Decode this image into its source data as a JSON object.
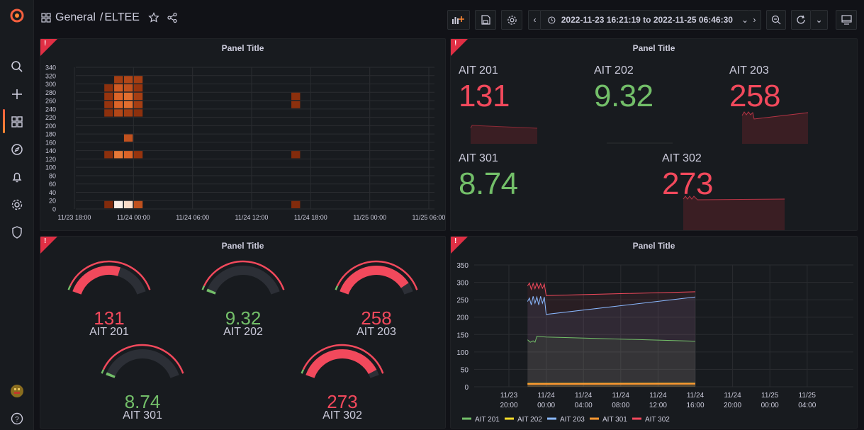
{
  "app": {
    "breadcrumb_folder": "General",
    "breadcrumb_sep": "/",
    "breadcrumb_dashboard": "ELTEE",
    "time_range": "2022-11-23 16:21:19 to 2022-11-25 06:46:30"
  },
  "sidebar": {
    "items": [
      {
        "icon": "grafana-logo-icon"
      },
      {
        "icon": "search-icon"
      },
      {
        "icon": "plus-icon"
      },
      {
        "icon": "dashboards-icon"
      },
      {
        "icon": "explore-compass-icon"
      },
      {
        "icon": "alerting-bell-icon"
      },
      {
        "icon": "config-gear-icon"
      },
      {
        "icon": "shield-icon"
      },
      {
        "icon": "user-avatar-icon"
      },
      {
        "icon": "help-icon"
      }
    ]
  },
  "panels": {
    "heatmap": {
      "title": "Panel Title",
      "error_mark": "!"
    },
    "stats": {
      "title": "Panel Title",
      "error_mark": "!"
    },
    "gauges": {
      "title": "Panel Title",
      "error_mark": "!"
    },
    "timeseries": {
      "title": "Panel Title",
      "error_mark": "!"
    }
  },
  "colors": {
    "red": "#f2495c",
    "green": "#73bf69",
    "blue": "#8ab8ff",
    "yellow": "#fade2a",
    "orange": "#ff9830",
    "bg": "#111217",
    "panel": "#181b1f"
  },
  "stats": [
    {
      "label": "AIT 201",
      "value": "131",
      "color": "#f2495c"
    },
    {
      "label": "AIT 202",
      "value": "9.32",
      "color": "#73bf69"
    },
    {
      "label": "AIT 203",
      "value": "258",
      "color": "#f2495c"
    },
    {
      "label": "AIT 301",
      "value": "8.74",
      "color": "#73bf69"
    },
    {
      "label": "AIT 302",
      "value": "273",
      "color": "#f2495c"
    }
  ],
  "gauges": [
    {
      "label": "AIT 201",
      "value": "131",
      "fraction": 0.62,
      "color": "#f2495c"
    },
    {
      "label": "AIT 202",
      "value": "9.32",
      "fraction": 0.03,
      "color": "#73bf69"
    },
    {
      "label": "AIT 203",
      "value": "258",
      "fraction": 0.9,
      "color": "#f2495c"
    },
    {
      "label": "AIT 301",
      "value": "8.74",
      "fraction": 0.03,
      "color": "#73bf69"
    },
    {
      "label": "AIT 302",
      "value": "273",
      "fraction": 0.94,
      "color": "#f2495c"
    }
  ],
  "chart_data": [
    {
      "type": "heatmap",
      "title": "Panel Title",
      "yticks": [
        0,
        20,
        40,
        60,
        80,
        100,
        120,
        140,
        160,
        180,
        200,
        220,
        240,
        260,
        280,
        300,
        320,
        340
      ],
      "xticks": [
        "11/23 18:00",
        "11/24 00:00",
        "11/24 06:00",
        "11/24 12:00",
        "11/24 18:00",
        "11/25 00:00",
        "11/25 06:00"
      ],
      "cells": [
        {
          "x": "11/23 21:00",
          "y": 0,
          "intensity": 0.2
        },
        {
          "x": "11/23 22:00",
          "y": 0,
          "intensity": 1.0
        },
        {
          "x": "11/23 23:00",
          "y": 0,
          "intensity": 0.95
        },
        {
          "x": "11/24 00:00",
          "y": 0,
          "intensity": 0.45
        },
        {
          "x": "11/24 16:00",
          "y": 0,
          "intensity": 0.2
        },
        {
          "x": "11/23 21:00",
          "y": 120,
          "intensity": 0.25
        },
        {
          "x": "11/23 22:00",
          "y": 120,
          "intensity": 0.65
        },
        {
          "x": "11/23 23:00",
          "y": 120,
          "intensity": 0.55
        },
        {
          "x": "11/24 00:00",
          "y": 120,
          "intensity": 0.3
        },
        {
          "x": "11/24 16:00",
          "y": 120,
          "intensity": 0.2
        },
        {
          "x": "11/23 23:00",
          "y": 160,
          "intensity": 0.45
        },
        {
          "x": "11/23 21:00",
          "y": 220,
          "intensity": 0.25
        },
        {
          "x": "11/23 22:00",
          "y": 220,
          "intensity": 0.4
        },
        {
          "x": "11/23 23:00",
          "y": 220,
          "intensity": 0.35
        },
        {
          "x": "11/24 00:00",
          "y": 220,
          "intensity": 0.25
        },
        {
          "x": "11/23 21:00",
          "y": 240,
          "intensity": 0.3
        },
        {
          "x": "11/23 22:00",
          "y": 240,
          "intensity": 0.55
        },
        {
          "x": "11/23 23:00",
          "y": 240,
          "intensity": 0.6
        },
        {
          "x": "11/24 00:00",
          "y": 240,
          "intensity": 0.35
        },
        {
          "x": "11/24 16:00",
          "y": 240,
          "intensity": 0.25
        },
        {
          "x": "11/23 21:00",
          "y": 260,
          "intensity": 0.3
        },
        {
          "x": "11/23 22:00",
          "y": 260,
          "intensity": 0.55
        },
        {
          "x": "11/23 23:00",
          "y": 260,
          "intensity": 0.6
        },
        {
          "x": "11/24 00:00",
          "y": 260,
          "intensity": 0.35
        },
        {
          "x": "11/24 16:00",
          "y": 260,
          "intensity": 0.25
        },
        {
          "x": "11/23 21:00",
          "y": 280,
          "intensity": 0.25
        },
        {
          "x": "11/23 22:00",
          "y": 280,
          "intensity": 0.5
        },
        {
          "x": "11/23 23:00",
          "y": 280,
          "intensity": 0.45
        },
        {
          "x": "11/24 00:00",
          "y": 280,
          "intensity": 0.3
        },
        {
          "x": "11/23 22:00",
          "y": 300,
          "intensity": 0.35
        },
        {
          "x": "11/23 23:00",
          "y": 300,
          "intensity": 0.4
        },
        {
          "x": "11/24 00:00",
          "y": 300,
          "intensity": 0.35
        }
      ]
    },
    {
      "type": "line",
      "title": "Panel Title",
      "ylim": [
        0,
        350
      ],
      "yticks": [
        0,
        50,
        100,
        150,
        200,
        250,
        300,
        350
      ],
      "xticks": [
        {
          "l1": "11/23",
          "l2": "20:00"
        },
        {
          "l1": "11/24",
          "l2": "00:00"
        },
        {
          "l1": "11/24",
          "l2": "04:00"
        },
        {
          "l1": "11/24",
          "l2": "08:00"
        },
        {
          "l1": "11/24",
          "l2": "12:00"
        },
        {
          "l1": "11/24",
          "l2": "16:00"
        },
        {
          "l1": "11/24",
          "l2": "20:00"
        },
        {
          "l1": "11/25",
          "l2": "00:00"
        },
        {
          "l1": "11/25",
          "l2": "04:00"
        }
      ],
      "x_start_hours": 22,
      "series": [
        {
          "name": "AIT 201",
          "color": "#73bf69",
          "points": [
            [
              22,
              135
            ],
            [
              22.3,
              128
            ],
            [
              22.6,
              132
            ],
            [
              22.8,
              128
            ],
            [
              23,
              145
            ],
            [
              24,
              143
            ],
            [
              40,
              131
            ]
          ]
        },
        {
          "name": "AIT 202",
          "color": "#fade2a",
          "points": [
            [
              22,
              9
            ],
            [
              40,
              9.3
            ]
          ]
        },
        {
          "name": "AIT 203",
          "color": "#8ab8ff",
          "points": [
            [
              22,
              245
            ],
            [
              22.2,
              255
            ],
            [
              22.4,
              235
            ],
            [
              22.6,
              260
            ],
            [
              22.8,
              240
            ],
            [
              23,
              258
            ],
            [
              23.2,
              235
            ],
            [
              23.4,
              260
            ],
            [
              23.6,
              240
            ],
            [
              23.8,
              258
            ],
            [
              24,
              208
            ],
            [
              40,
              258
            ]
          ]
        },
        {
          "name": "AIT 301",
          "color": "#ff9830",
          "points": [
            [
              22,
              8
            ],
            [
              40,
              8.7
            ]
          ]
        },
        {
          "name": "AIT 302",
          "color": "#f2495c",
          "points": [
            [
              22,
              290
            ],
            [
              22.2,
              298
            ],
            [
              22.4,
              280
            ],
            [
              22.6,
              297
            ],
            [
              22.8,
              282
            ],
            [
              23,
              298
            ],
            [
              23.2,
              282
            ],
            [
              23.4,
              296
            ],
            [
              23.6,
              283
            ],
            [
              23.8,
              295
            ],
            [
              24,
              262
            ],
            [
              40,
              273
            ]
          ]
        }
      ]
    }
  ]
}
